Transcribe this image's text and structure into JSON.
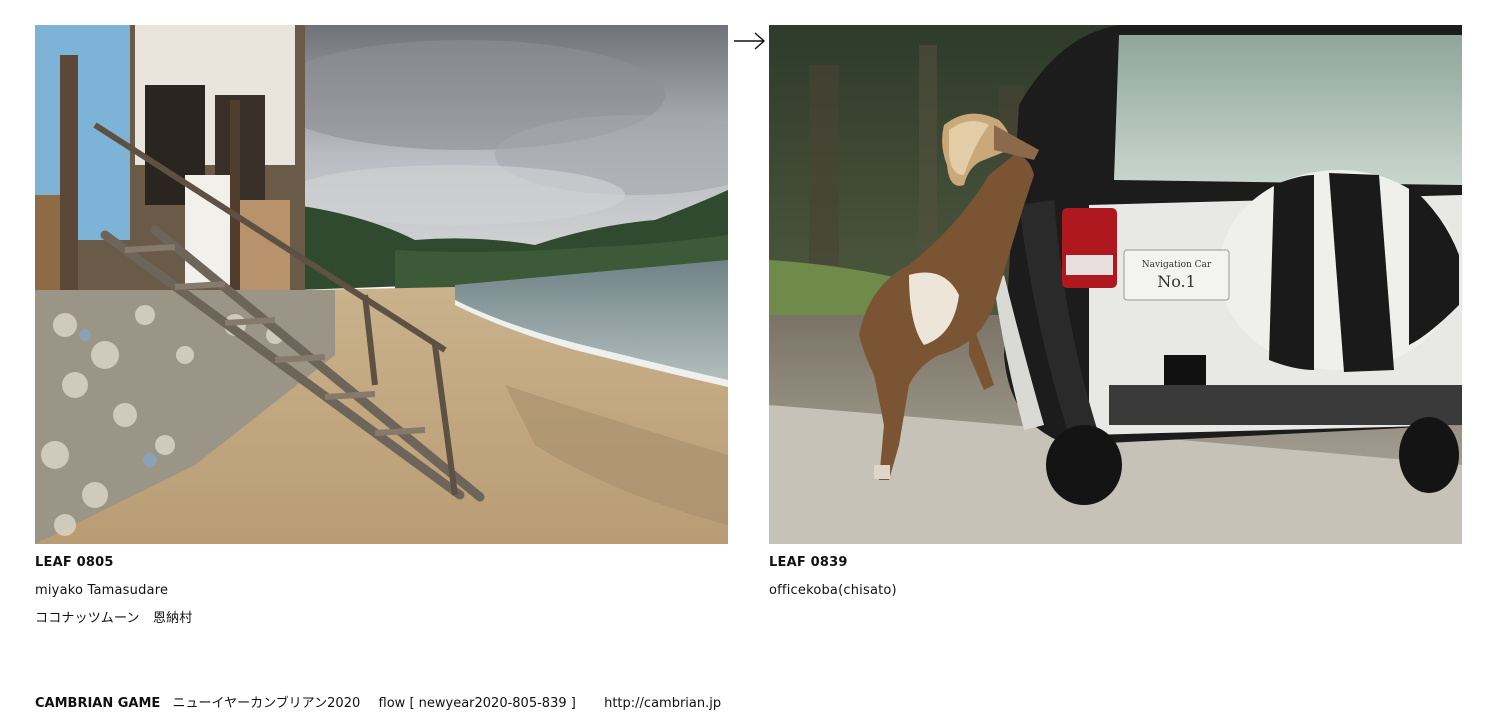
{
  "leaves": [
    {
      "id": "LEAF 0805",
      "author": "miyako Tamasudare",
      "note": "ココナッツムーン　恩納村"
    },
    {
      "id": "LEAF 0839",
      "author": "officekoba(chisato)",
      "note": "",
      "car_label_1": "Navigation Car",
      "car_label_2": "No.1"
    }
  ],
  "footer": {
    "brand": "CAMBRIAN GAME",
    "title": "ニューイヤーカンブリアン2020",
    "flow": "flow [ newyear2020-805-839 ]",
    "url": "http://cambrian.jp"
  },
  "icons": {
    "next": "right-arrow-icon"
  },
  "colors": {
    "text": "#111111",
    "background": "#ffffff"
  }
}
